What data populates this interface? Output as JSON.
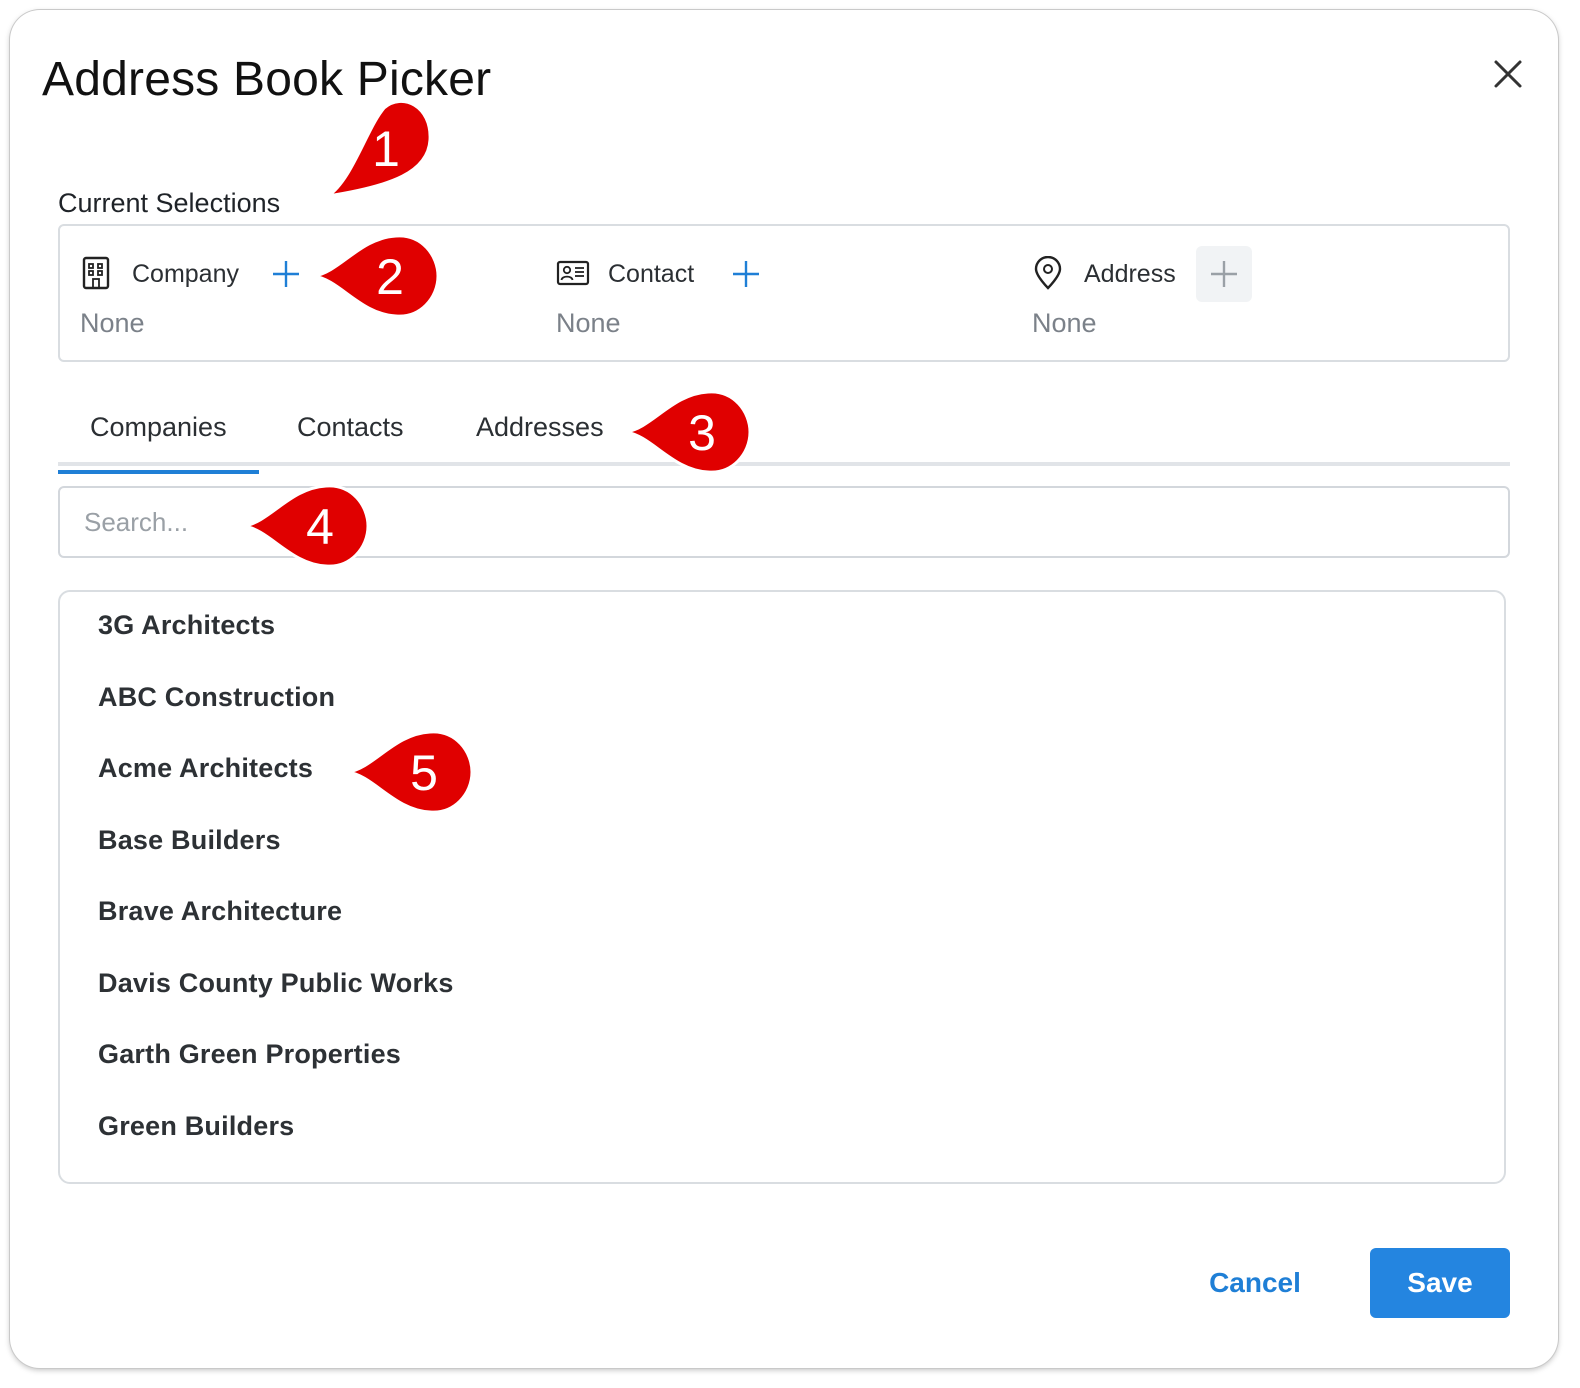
{
  "dialog": {
    "title": "Address Book Picker"
  },
  "current_selections": {
    "label": "Current Selections",
    "items": [
      {
        "label": "Company",
        "value": "None",
        "icon": "building-icon"
      },
      {
        "label": "Contact",
        "value": "None",
        "icon": "contact-card-icon"
      },
      {
        "label": "Address",
        "value": "None",
        "icon": "map-pin-icon"
      }
    ]
  },
  "tabs": [
    {
      "label": "Companies",
      "active": true
    },
    {
      "label": "Contacts",
      "active": false
    },
    {
      "label": "Addresses",
      "active": false
    }
  ],
  "search": {
    "placeholder": "Search...",
    "value": ""
  },
  "list": {
    "items": [
      "3G Architects",
      "ABC Construction",
      "Acme Architects",
      "Base Builders",
      "Brave Architecture",
      "Davis County Public Works",
      "Garth Green Properties",
      "Green Builders"
    ]
  },
  "footer": {
    "cancel_label": "Cancel",
    "save_label": "Save"
  },
  "callouts": [
    "1",
    "2",
    "3",
    "4",
    "5"
  ],
  "colors": {
    "accent": "#2485e0",
    "link": "#1f7fd6",
    "callout": "#e00000",
    "muted_text": "#7b8189"
  }
}
